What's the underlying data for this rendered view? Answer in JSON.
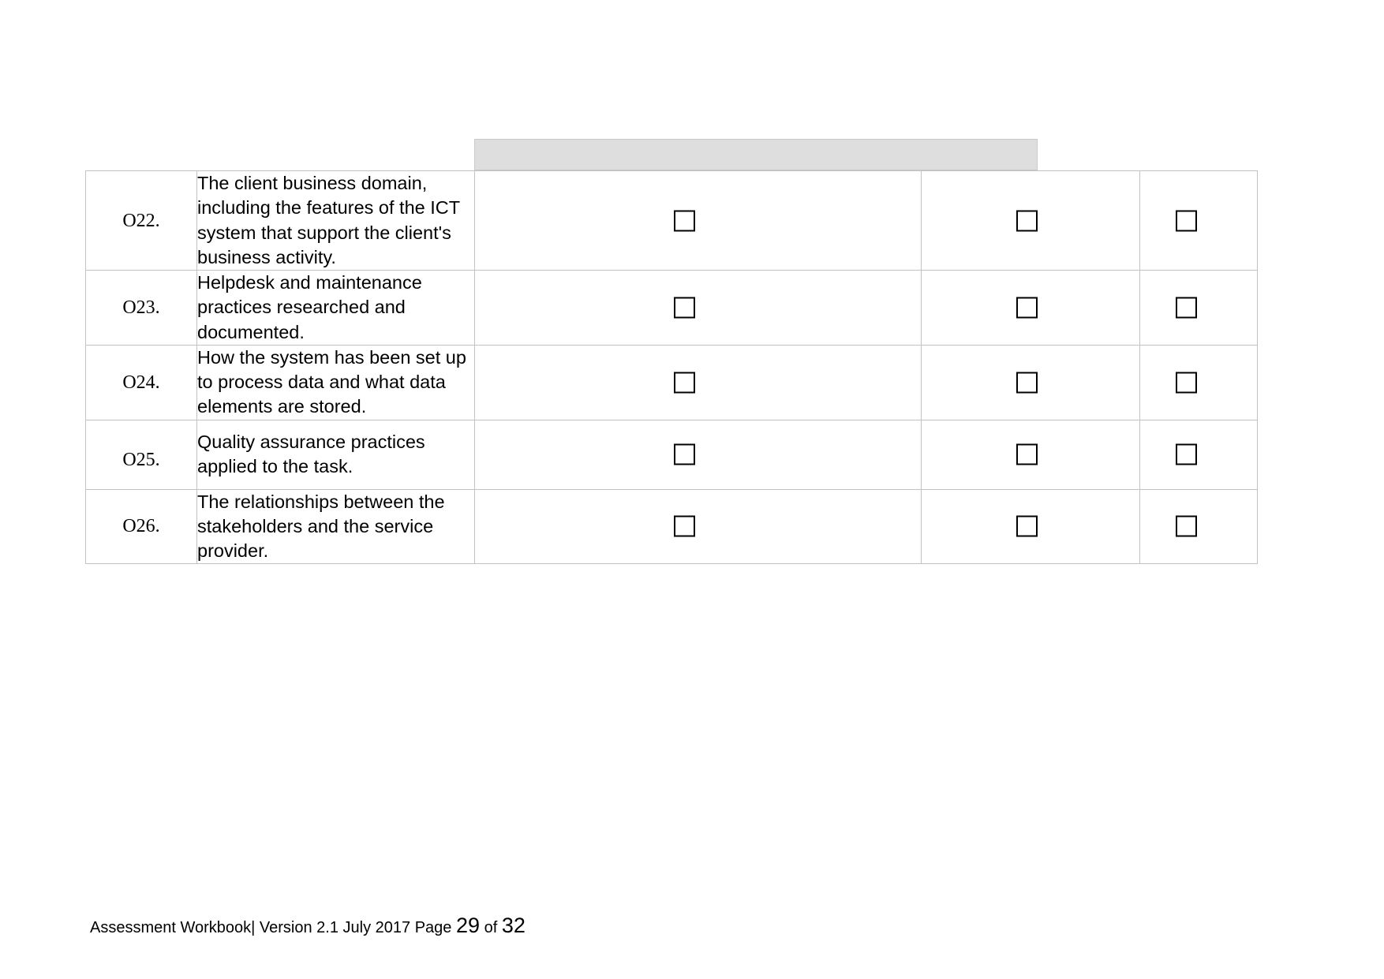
{
  "document": {
    "type": "assessment-workbook-checklist-page"
  },
  "header_band": {
    "label": "",
    "fill_color": "#dedede",
    "border_color": "#c9c9c9"
  },
  "table": {
    "border_color": "#c2c2c2",
    "columns": [
      {
        "key": "id",
        "header": ""
      },
      {
        "key": "description",
        "header": ""
      },
      {
        "key": "checkbox_a",
        "header": ""
      },
      {
        "key": "checkbox_b",
        "header": ""
      },
      {
        "key": "checkbox_c",
        "header": ""
      }
    ],
    "rows": [
      {
        "id": "O22.",
        "description": "The client business domain, including the features of the ICT system that support the client's business activity.",
        "checkbox_a": false,
        "checkbox_b": false,
        "checkbox_c": false
      },
      {
        "id": "O23.",
        "description": "Helpdesk and maintenance practices researched and documented.",
        "checkbox_a": false,
        "checkbox_b": false,
        "checkbox_c": false
      },
      {
        "id": "O24.",
        "description": "How the system has been set up to process data and what data elements are stored.",
        "checkbox_a": false,
        "checkbox_b": false,
        "checkbox_c": false
      },
      {
        "id": "O25.",
        "description": "Quality assurance practices applied to the task.",
        "checkbox_a": false,
        "checkbox_b": false,
        "checkbox_c": false
      },
      {
        "id": "O26.",
        "description": "The relationships between the stakeholders and the service provider.",
        "checkbox_a": false,
        "checkbox_b": false,
        "checkbox_c": false
      }
    ]
  },
  "footer": {
    "title": "Assessment Workbook| Version 2.1 July 2017 Page ",
    "page_number": "29",
    "of_label": " of ",
    "total_pages": "32"
  }
}
